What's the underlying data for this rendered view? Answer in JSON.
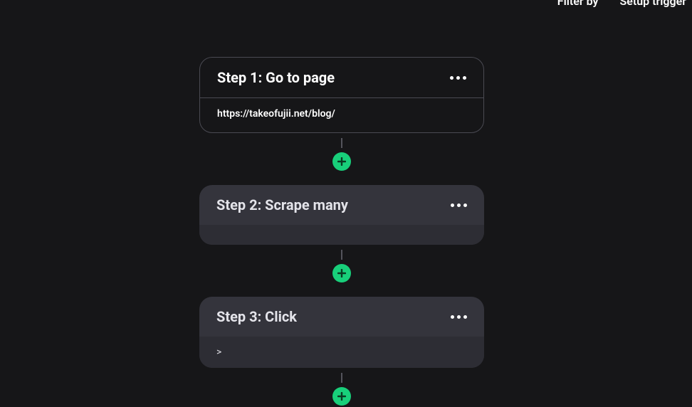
{
  "toolbar": {
    "filter_label": "Filter by",
    "setup_label": "Setup trigger"
  },
  "steps": [
    {
      "title": "Step 1: Go to page",
      "body": "https://takeofujii.net/blog/"
    },
    {
      "title": "Step 2: Scrape many",
      "body": ""
    },
    {
      "title": "Step 3: Click",
      "body": ">"
    }
  ]
}
